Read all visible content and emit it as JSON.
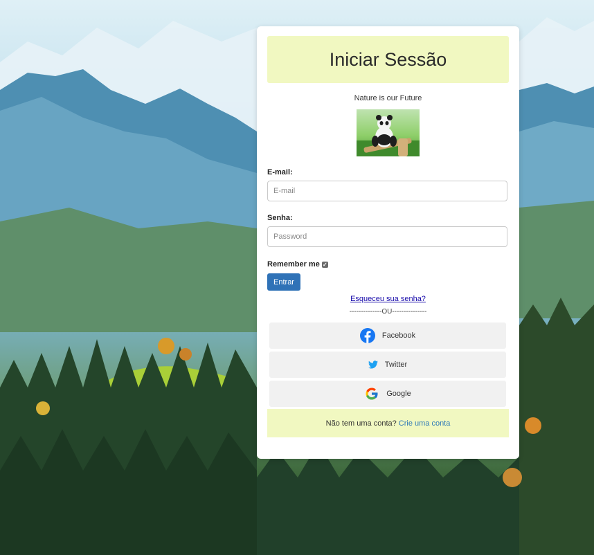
{
  "page": {
    "title": "Iniciar Sessão",
    "tagline": "Nature is our Future"
  },
  "form": {
    "email_label": "E-mail:",
    "email_placeholder": "E-mail",
    "email_value": "",
    "password_label": "Senha:",
    "password_placeholder": "Password",
    "password_value": "",
    "remember_label": "Remember me",
    "remember_checked": true,
    "submit_label": "Entrar",
    "forgot_label": "Esqueceu sua senha?",
    "divider": "--------------OU---------------"
  },
  "social": [
    {
      "label": "Facebook",
      "icon": "facebook-icon",
      "color": "#1877f2"
    },
    {
      "label": "Twitter",
      "icon": "twitter-icon",
      "color": "#1da1f2"
    },
    {
      "label": "Google",
      "icon": "google-icon",
      "color": "#4285f4"
    }
  ],
  "signup": {
    "prompt": "Não tem uma conta?",
    "link": "Crie uma conta"
  },
  "colors": {
    "accent_box": "#f1f8c1",
    "primary_button": "#2f72b7",
    "link": "#2e7ab7"
  }
}
